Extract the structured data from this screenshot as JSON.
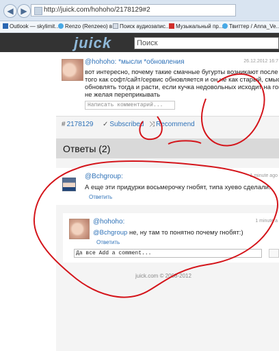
{
  "browser": {
    "back_glyph": "◀",
    "forward_glyph": "▶",
    "url": "http://juick.com/hohoho/2178129#2",
    "bookmarks": [
      {
        "label": "Outlook — skylimit…",
        "icon": "outlook-icon"
      },
      {
        "label": "Renzo (Renzeeo) в ...",
        "icon": "twitter-icon"
      },
      {
        "label": "Поиск аудиозапис...",
        "icon": "document-icon"
      },
      {
        "label": "Музыкальный пр...",
        "icon": "red-icon"
      },
      {
        "label": "Твиттер / Anna_Ve...",
        "icon": "twitter-icon"
      }
    ]
  },
  "site": {
    "logo": "juick",
    "search_placeholder": "Поиск"
  },
  "post": {
    "author": "@hohoho:",
    "tags": "*мысли *обновления",
    "time": "26.12.2012 16:7",
    "text_lines": [
      "вот интересно, почему такие смачные бугурты возникают после",
      "того как софт/сайт/сервис обновляется и он не как старый, смысл",
      "обновлять тогда и расти, если кучка недовольных исходит на говн",
      "не желая переприкывать"
    ],
    "comment_placeholder": "Написать комментарий...",
    "meta": {
      "id": "2178129",
      "subscribed": "Subscribed",
      "recommend": "Recommend"
    }
  },
  "answers": {
    "title": "Ответы (2)"
  },
  "replies": [
    {
      "author": "@Bchgroup:",
      "time": "1 minute ago",
      "text": "А еще эти придурки восьмерочку гнобят, типа хуево сделали.",
      "reply_label": "Ответить"
    },
    {
      "author": "@hohoho:",
      "time": "1 minute a",
      "mention": "@Bchgroup",
      "text": " не, ну там то понятно почему гнобят:)",
      "reply_label": "Ответить",
      "input_text": "Да все Add a comment..."
    }
  ],
  "footer": {
    "copyright": "juick.com © 2008-2012"
  },
  "colors": {
    "top_bar": "#333333",
    "logo": "#8fb8d8",
    "link": "#2f72b8",
    "annotation_red": "#d4141a"
  }
}
